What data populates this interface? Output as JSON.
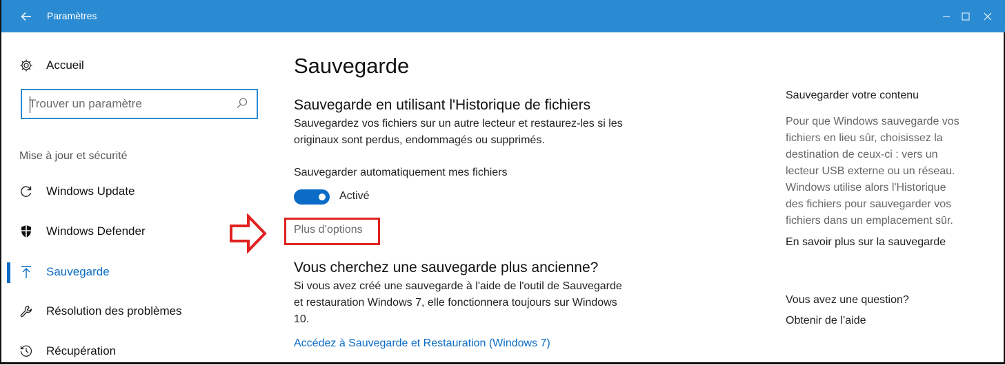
{
  "window": {
    "title": "Paramètres",
    "accent": "#2b8bd2"
  },
  "sidebar": {
    "home_label": "Accueil",
    "search_placeholder": "Trouver un paramètre",
    "section": "Mise à jour et sécurité",
    "items": [
      {
        "label": "Windows Update",
        "icon": "refresh-icon",
        "active": false
      },
      {
        "label": "Windows Defender",
        "icon": "shield-icon",
        "active": false
      },
      {
        "label": "Sauvegarde",
        "icon": "upload-arrow-icon",
        "active": true
      },
      {
        "label": "Résolution des problèmes",
        "icon": "wrench-icon",
        "active": false
      },
      {
        "label": "Récupération",
        "icon": "history-icon",
        "active": false
      }
    ]
  },
  "main": {
    "title": "Sauvegarde",
    "file_history": {
      "heading": "Sauvegarde en utilisant l'Historique de fichiers",
      "desc_line1": "Sauvegardez vos fichiers sur un autre lecteur et restaurez-les si les",
      "desc_line2": "originaux sont perdus, endommagés ou supprimés.",
      "auto_label": "Sauvegarder automatiquement mes fichiers",
      "toggle_state": "Activé",
      "more_options": "Plus d’options"
    },
    "older_backup": {
      "heading": "Vous cherchez une sauvegarde plus ancienne?",
      "line1": "Si vous avez créé une sauvegarde à l'aide de l'outil de Sauvegarde",
      "line2": "et restauration Windows 7, elle fonctionnera toujours sur Windows",
      "line3": "10.",
      "link": "Accédez à Sauvegarde et Restauration (Windows 7)"
    }
  },
  "side": {
    "heading": "Sauvegarder votre contenu",
    "text_lines": [
      "Pour que Windows sauvegarde vos",
      "fichiers en lieu sûr, choisissez la",
      "destination de ceux-ci : vers un",
      "lecteur USB externe ou un réseau.",
      "Windows utilise alors l'Historique",
      "des fichiers pour sauvegarder vos",
      "fichiers dans un emplacement sûr."
    ],
    "learn_link": "En savoir plus sur la sauvegarde",
    "question_heading": "Vous avez une question?",
    "help_link": "Obtenir de l’aide"
  },
  "annotation_color": "#e0211f"
}
